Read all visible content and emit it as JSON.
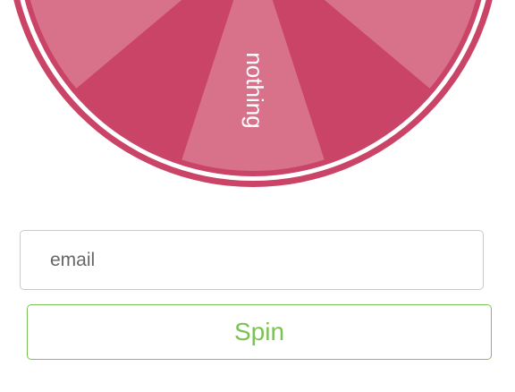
{
  "wheel": {
    "segments": [
      {
        "label": "",
        "color": "#d8728a"
      },
      {
        "label": "",
        "color": "#ca4468"
      },
      {
        "label": "nothing",
        "color": "#d8728a"
      },
      {
        "label": "",
        "color": "#ca4468"
      },
      {
        "label": "",
        "color": "#d8728a"
      }
    ],
    "rim_color": "#ca4468",
    "gap_color": "#ffffff",
    "text_color": "#ffffff"
  },
  "form": {
    "email_placeholder": "email",
    "email_value": "",
    "spin_label": "Spin"
  },
  "colors": {
    "accent": "#7cc156",
    "input_border": "#c9c9c9"
  }
}
